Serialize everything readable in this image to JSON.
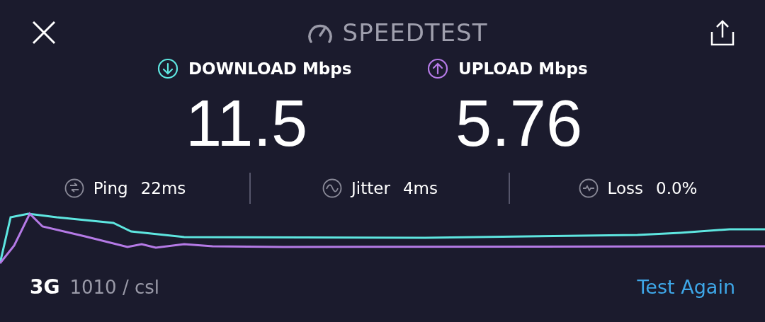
{
  "header": {
    "title": "SPEEDTEST"
  },
  "metrics": [
    {
      "kind": "download",
      "label": "DOWNLOAD Mbps",
      "value": "11.5",
      "color": "#5ee6e0"
    },
    {
      "kind": "upload",
      "label": "UPLOAD Mbps",
      "value": "5.76",
      "color": "#b57ae6"
    }
  ],
  "stats": [
    {
      "kind": "ping",
      "label": "Ping",
      "value": "22ms"
    },
    {
      "kind": "jitter",
      "label": "Jitter",
      "value": "4ms"
    },
    {
      "kind": "loss",
      "label": "Loss",
      "value": "0.0%"
    }
  ],
  "footer": {
    "network": "3G",
    "provider": "1010 / csl",
    "button": "Test Again"
  }
}
